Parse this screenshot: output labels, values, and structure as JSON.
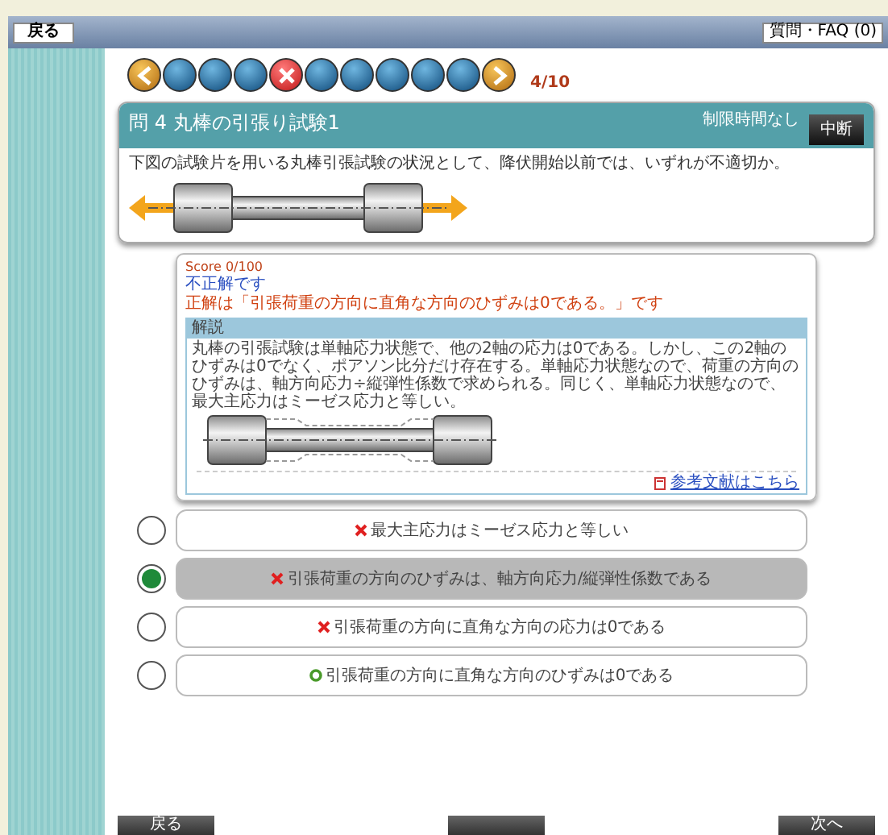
{
  "top_bar": {
    "back_button": "戻る",
    "faq_button": "質問・FAQ (0)"
  },
  "navigation": {
    "dots": [
      {
        "kind": "prev"
      },
      {
        "kind": "pending"
      },
      {
        "kind": "pending"
      },
      {
        "kind": "pending"
      },
      {
        "kind": "wrong"
      },
      {
        "kind": "pending"
      },
      {
        "kind": "pending"
      },
      {
        "kind": "pending"
      },
      {
        "kind": "pending"
      },
      {
        "kind": "pending"
      },
      {
        "kind": "next"
      }
    ],
    "progress": "4/10"
  },
  "question": {
    "title": "問 4  丸棒の引張り試験1",
    "time_limit": "制限時間なし",
    "suspend_button": "中断",
    "text": "下図の試験片を用いる丸棒引張試験の状況として、降伏開始以前では、いずれが不適切か。"
  },
  "feedback": {
    "score": "Score 0/100",
    "verdict": "不正解です",
    "correct_answer": "正解は「引張荷重の方向に直角な方向のひずみは0である。」です",
    "explanation_title": "解説",
    "explanation": "丸棒の引張試験は単軸応力状態で、他の2軸の応力は0である。しかし、この2軸のひずみは0でなく、ポアソン比分だけ存在する。単軸応力状態なので、荷重の方向のひずみは、軸方向応力÷縦弾性係数で求められる。同じく、単軸応力状態なので、最大主応力はミーゼス応力と等しい。",
    "reference_link": "参考文献はこちら"
  },
  "options": [
    {
      "text": "最大主応力はミーゼス応力と等しい",
      "correct": false,
      "selected": false
    },
    {
      "text": "引張荷重の方向のひずみは、軸方向応力/縦弾性係数である",
      "correct": false,
      "selected": true
    },
    {
      "text": "引張荷重の方向に直角な方向の応力は0である",
      "correct": false,
      "selected": false
    },
    {
      "text": "引張荷重の方向に直角な方向のひずみは0である",
      "correct": true,
      "selected": false
    }
  ],
  "bottom_buttons": {
    "back": "戻る",
    "next": "次へ"
  }
}
